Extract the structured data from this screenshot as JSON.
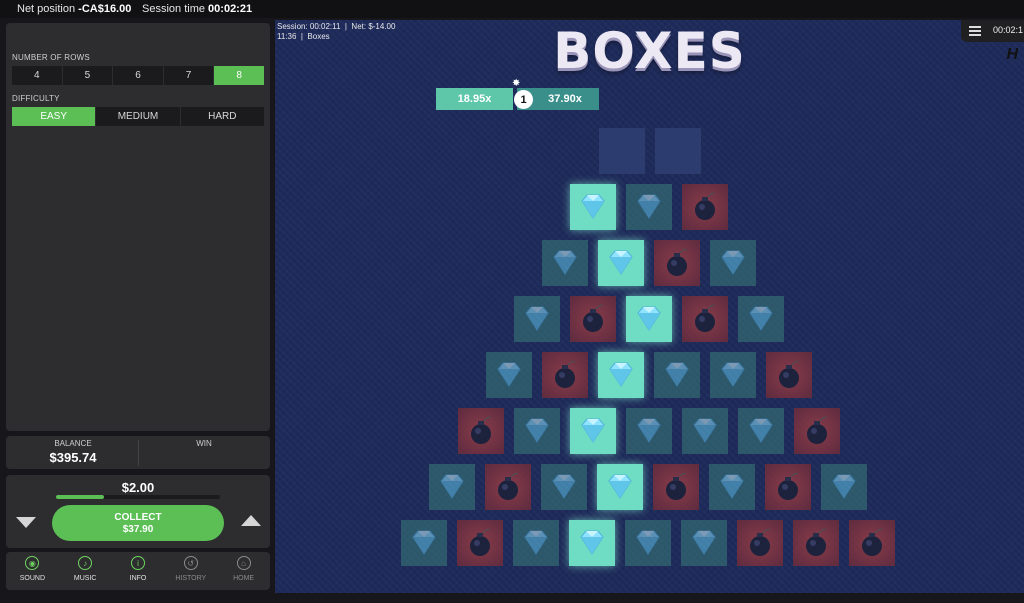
{
  "topbar": {
    "net_label": "Net position",
    "net_value": "-CA$16.00",
    "session_label": "Session time",
    "session_value": "00:02:21"
  },
  "settings": {
    "rows_label": "NUMBER OF ROWS",
    "rows_options": [
      "4",
      "5",
      "6",
      "7",
      "8"
    ],
    "rows_selected": "8",
    "difficulty_label": "DIFFICULTY",
    "difficulty_options": [
      "EASY",
      "MEDIUM",
      "HARD"
    ],
    "difficulty_selected": "EASY"
  },
  "balance": {
    "label": "BALANCE",
    "value": "$395.74",
    "win_label": "WIN",
    "win_value": ""
  },
  "bet": {
    "amount": "$2.00",
    "slider_fraction": 0.29,
    "collect_label": "COLLECT",
    "collect_amount": "$37.90"
  },
  "nav": [
    {
      "label": "SOUND",
      "icon": "sound-icon",
      "glyph": "◉",
      "active": true
    },
    {
      "label": "MUSIC",
      "icon": "music-note-icon",
      "glyph": "♪",
      "active": true
    },
    {
      "label": "INFO",
      "icon": "info-icon",
      "glyph": "i",
      "active": true
    },
    {
      "label": "HISTORY",
      "icon": "history-icon",
      "glyph": "↺",
      "active": false
    },
    {
      "label": "HOME",
      "icon": "home-icon",
      "glyph": "⌂",
      "active": false
    }
  ],
  "game": {
    "session_line1": "Session: 00:02:11",
    "session_net": "Net:  $-14.00",
    "session_line2": "11:36",
    "session_game": "Boxes",
    "logo": "BOXES",
    "menu_time": "00:02:1",
    "brand": "H",
    "multiplier_left": "18.95x",
    "pointer_value": "1",
    "multiplier_right": "37.90x",
    "rows": [
      [
        "pending",
        "pending"
      ],
      [
        "win",
        "gem",
        "bomb"
      ],
      [
        "gem",
        "win",
        "bomb",
        "gem"
      ],
      [
        "gem",
        "bomb",
        "win",
        "bomb",
        "gem"
      ],
      [
        "gem",
        "bomb",
        "win",
        "gem",
        "gem",
        "bomb"
      ],
      [
        "bomb",
        "gem",
        "win",
        "gem",
        "gem",
        "gem",
        "bomb"
      ],
      [
        "gem",
        "bomb",
        "gem",
        "win",
        "bomb",
        "gem",
        "bomb",
        "gem"
      ],
      [
        "gem",
        "bomb",
        "gem",
        "win",
        "gem",
        "gem",
        "bomb",
        "bomb",
        "bomb"
      ]
    ]
  }
}
